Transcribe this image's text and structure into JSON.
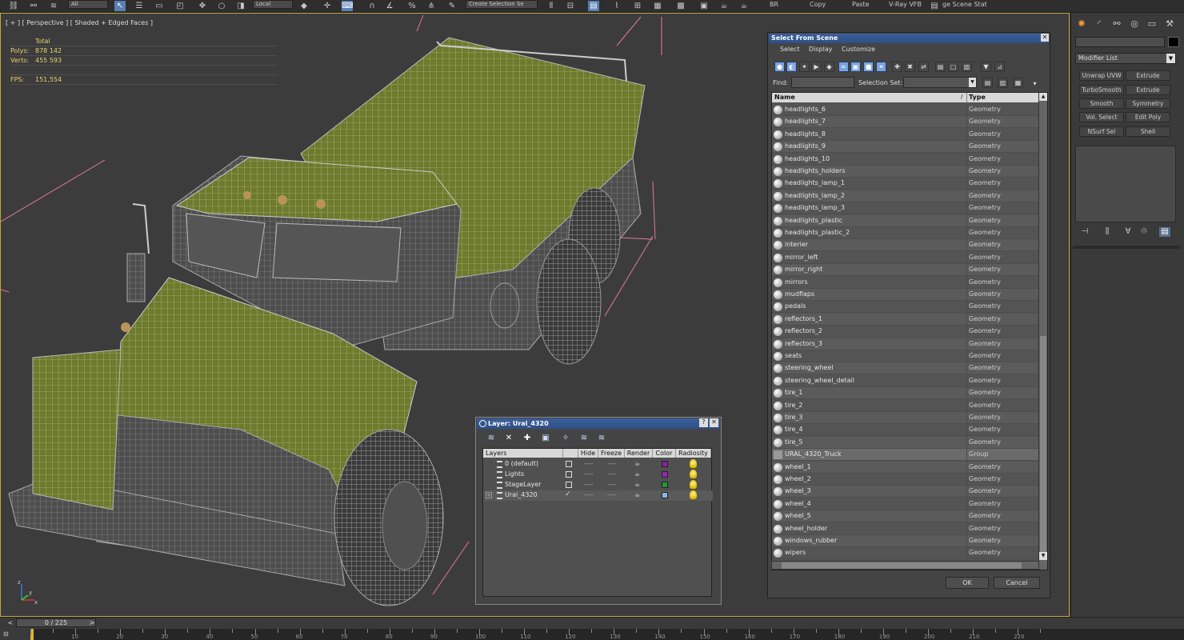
{
  "toolbar": {
    "filter_combo": "All",
    "coord_combo": "Local",
    "selection_set_combo": "Create Selection Se",
    "br_label": "BR",
    "copy_label": "Copy",
    "paste_label": "Paste",
    "vfb_label": "V-Ray VFB",
    "scene_states_label": "ge Scene Stat"
  },
  "viewport": {
    "label": "[ + ] [ Perspective ] [ Shaded + Edged Faces ]",
    "stats": {
      "total_header": "Total",
      "polys_label": "Polys:",
      "polys_value": "878 142",
      "verts_label": "Verts:",
      "verts_value": "455 593",
      "fps_label": "FPS:",
      "fps_value": "151,554"
    },
    "gizmo": {
      "x": "x",
      "y": "y",
      "z": "z"
    }
  },
  "command_panel": {
    "modifier_list": "Modifier List",
    "modifier_buttons": [
      "Unwrap UVW",
      "Extrude",
      "TurboSmooth",
      "Extrude",
      "Smooth",
      "Symmetry",
      "Vol. Select",
      "Edit Poly",
      "NSurf Sel",
      "Shell"
    ]
  },
  "select_from_scene": {
    "title": "Select From Scene",
    "menu": [
      "Select",
      "Display",
      "Customize"
    ],
    "find_label": "Find:",
    "find_value": "",
    "selection_set_label": "Selection Set:",
    "selection_set_value": "",
    "columns": {
      "name": "Name",
      "type": "Type"
    },
    "rows": [
      {
        "name": "headlights_6",
        "type": "Geometry"
      },
      {
        "name": "headlights_7",
        "type": "Geometry"
      },
      {
        "name": "headlights_8",
        "type": "Geometry"
      },
      {
        "name": "headlights_9",
        "type": "Geometry"
      },
      {
        "name": "headlights_10",
        "type": "Geometry"
      },
      {
        "name": "headlights_holders",
        "type": "Geometry"
      },
      {
        "name": "headlights_lamp_1",
        "type": "Geometry"
      },
      {
        "name": "headlights_lamp_2",
        "type": "Geometry"
      },
      {
        "name": "headlights_lamp_3",
        "type": "Geometry"
      },
      {
        "name": "headlights_plastic",
        "type": "Geometry"
      },
      {
        "name": "headlights_plastic_2",
        "type": "Geometry"
      },
      {
        "name": "interier",
        "type": "Geometry"
      },
      {
        "name": "mirror_left",
        "type": "Geometry"
      },
      {
        "name": "mirror_right",
        "type": "Geometry"
      },
      {
        "name": "mirrors",
        "type": "Geometry"
      },
      {
        "name": "mudflaps",
        "type": "Geometry"
      },
      {
        "name": "pedals",
        "type": "Geometry"
      },
      {
        "name": "reflectors_1",
        "type": "Geometry"
      },
      {
        "name": "reflectors_2",
        "type": "Geometry"
      },
      {
        "name": "reflectors_3",
        "type": "Geometry"
      },
      {
        "name": "seats",
        "type": "Geometry"
      },
      {
        "name": "steering_wheel",
        "type": "Geometry"
      },
      {
        "name": "steering_wheel_detail",
        "type": "Geometry"
      },
      {
        "name": "tire_1",
        "type": "Geometry"
      },
      {
        "name": "tire_2",
        "type": "Geometry"
      },
      {
        "name": "tire_3",
        "type": "Geometry"
      },
      {
        "name": "tire_4",
        "type": "Geometry"
      },
      {
        "name": "tire_5",
        "type": "Geometry"
      },
      {
        "name": "URAL_4320_Truck",
        "type": "Group"
      },
      {
        "name": "wheel_1",
        "type": "Geometry"
      },
      {
        "name": "wheel_2",
        "type": "Geometry"
      },
      {
        "name": "wheel_3",
        "type": "Geometry"
      },
      {
        "name": "wheel_4",
        "type": "Geometry"
      },
      {
        "name": "wheel_5",
        "type": "Geometry"
      },
      {
        "name": "wheel_holder",
        "type": "Geometry"
      },
      {
        "name": "windows_rubber",
        "type": "Geometry"
      },
      {
        "name": "wipers",
        "type": "Geometry"
      }
    ],
    "ok_label": "OK",
    "cancel_label": "Cancel"
  },
  "layer_dialog": {
    "title": "Layer: Ural_4320",
    "help": "?",
    "columns": [
      "Layers",
      "Hide",
      "Freeze",
      "Render",
      "Color",
      "Radiosity"
    ],
    "layers": [
      {
        "name": "0 (default)",
        "color": "#8a1fa0",
        "current": false
      },
      {
        "name": "Lights",
        "color": "#9a22b0",
        "current": false
      },
      {
        "name": "StageLayer",
        "color": "#1f9a3a",
        "current": false
      },
      {
        "name": "Ural_4320",
        "color": "#8ab8e6",
        "current": true
      }
    ]
  },
  "timeline": {
    "frame": "0 / 225",
    "prev": "<",
    "next": ">",
    "ruler_labels": [
      "10",
      "20",
      "30",
      "40",
      "50",
      "60",
      "70",
      "80",
      "90",
      "100",
      "110",
      "120",
      "130",
      "140",
      "150",
      "160",
      "170",
      "180",
      "190",
      "200",
      "210",
      "220"
    ]
  }
}
